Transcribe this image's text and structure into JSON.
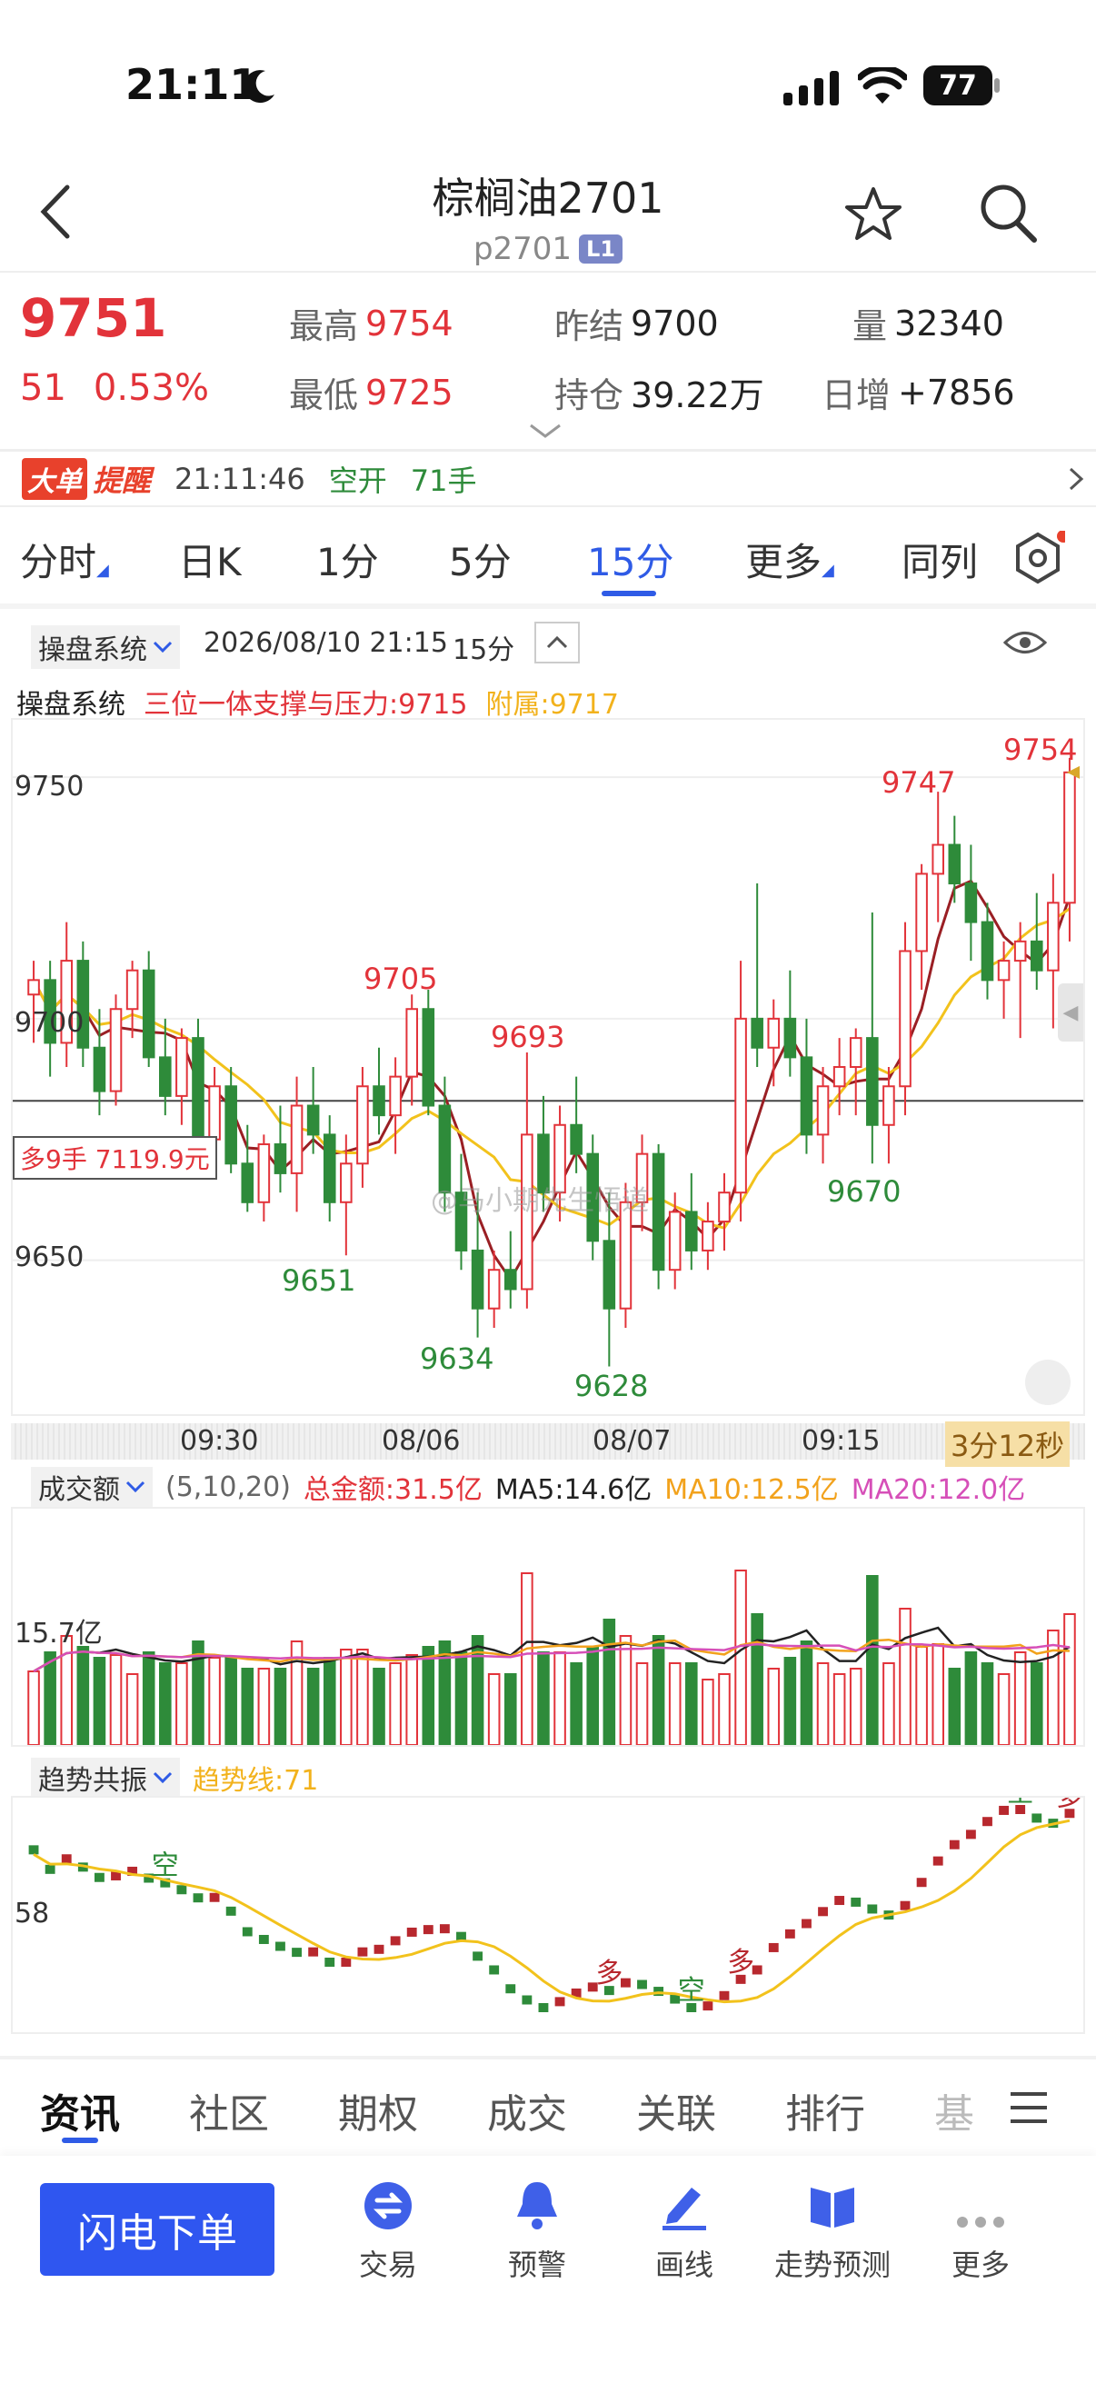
{
  "status_bar": {
    "time": "21:11",
    "battery": "77"
  },
  "header": {
    "title": "棕榈油2701",
    "code": "p2701",
    "level_badge": "L1"
  },
  "quote": {
    "price": "9751",
    "change": "51",
    "change_pct": "0.53%",
    "high_label": "最高",
    "high": "9754",
    "low_label": "最低",
    "low": "9725",
    "prev_settle_label": "昨结",
    "prev_settle": "9700",
    "oi_label": "持仓",
    "oi": "39.22万",
    "volume_label": "量",
    "volume": "32340",
    "daily_inc_label": "日增",
    "daily_inc": "+7856"
  },
  "alert": {
    "badge": "大单",
    "label": "提醒",
    "time": "21:11:46",
    "action": "空开",
    "lots": "71手"
  },
  "tabs": [
    {
      "label": "分时",
      "has_arrow": true
    },
    {
      "label": "日K"
    },
    {
      "label": "1分"
    },
    {
      "label": "5分"
    },
    {
      "label": "15分",
      "active": true
    },
    {
      "label": "更多",
      "has_arrow": true
    },
    {
      "label": "同列"
    }
  ],
  "chart_header": {
    "system_select": "操盘系统",
    "datetime": "2026/08/10 21:15",
    "period": "15分",
    "indicator_name": "操盘系统",
    "line1": "三位一体支撑与压力:9715",
    "line2": "附属:9717"
  },
  "main_chart": {
    "y_labels": [
      "9750",
      "9700",
      "9650"
    ],
    "x_labels": [
      "09:30",
      "08/06",
      "08/07",
      "09:15"
    ],
    "countdown": "3分12秒",
    "position_label": "多9手 7119.9元",
    "annotations": [
      "9754",
      "9747",
      "9705",
      "9693",
      "9651",
      "9634",
      "9628",
      "9670"
    ],
    "watermark": "@马小期先生悟道"
  },
  "volume_panel": {
    "select": "成交额",
    "params": "(5,10,20)",
    "total": "总金额:31.5亿",
    "ma5": "MA5:14.6亿",
    "ma10": "MA10:12.5亿",
    "ma20": "MA20:12.0亿",
    "y_label": "15.7亿"
  },
  "trend_panel": {
    "select": "趋势共振",
    "line": "趋势线:71",
    "y_label": "58",
    "tags": {
      "kong": "空",
      "duo": "多"
    }
  },
  "bottom_tabs": [
    "资讯",
    "社区",
    "期权",
    "成交",
    "关联",
    "排行",
    "基"
  ],
  "bottom_nav": {
    "primary": "闪电下单",
    "items": [
      "交易",
      "预警",
      "画线",
      "走势预测",
      "更多"
    ]
  },
  "chart_data": {
    "type": "candlestick",
    "title": "棕榈油2701 15分",
    "ylim": [
      9620,
      9760
    ],
    "series": [
      {
        "name": "candles",
        "ohlc": [
          [
            9705,
            9712,
            9695,
            9708
          ],
          [
            9708,
            9712,
            9688,
            9695
          ],
          [
            9695,
            9720,
            9690,
            9712
          ],
          [
            9712,
            9716,
            9690,
            9694
          ],
          [
            9694,
            9702,
            9680,
            9685
          ],
          [
            9685,
            9705,
            9682,
            9702
          ],
          [
            9702,
            9712,
            9696,
            9710
          ],
          [
            9710,
            9714,
            9690,
            9692
          ],
          [
            9692,
            9700,
            9680,
            9684
          ],
          [
            9684,
            9698,
            9678,
            9696
          ],
          [
            9696,
            9700,
            9672,
            9675
          ],
          [
            9675,
            9690,
            9668,
            9686
          ],
          [
            9686,
            9690,
            9668,
            9670
          ],
          [
            9670,
            9678,
            9660,
            9662
          ],
          [
            9662,
            9676,
            9658,
            9674
          ],
          [
            9674,
            9682,
            9664,
            9668
          ],
          [
            9668,
            9688,
            9660,
            9682
          ],
          [
            9682,
            9690,
            9672,
            9676
          ],
          [
            9676,
            9680,
            9658,
            9662
          ],
          [
            9662,
            9676,
            9651,
            9670
          ],
          [
            9670,
            9690,
            9665,
            9686
          ],
          [
            9686,
            9694,
            9676,
            9680
          ],
          [
            9680,
            9692,
            9672,
            9688
          ],
          [
            9688,
            9705,
            9682,
            9702
          ],
          [
            9702,
            9706,
            9680,
            9682
          ],
          [
            9682,
            9688,
            9660,
            9664
          ],
          [
            9664,
            9672,
            9648,
            9652
          ],
          [
            9652,
            9664,
            9634,
            9640
          ],
          [
            9640,
            9652,
            9636,
            9648
          ],
          [
            9648,
            9656,
            9640,
            9644
          ],
          [
            9644,
            9693,
            9640,
            9676
          ],
          [
            9676,
            9684,
            9660,
            9664
          ],
          [
            9664,
            9682,
            9658,
            9678
          ],
          [
            9678,
            9688,
            9668,
            9672
          ],
          [
            9672,
            9676,
            9650,
            9654
          ],
          [
            9654,
            9664,
            9628,
            9640
          ],
          [
            9640,
            9666,
            9636,
            9662
          ],
          [
            9662,
            9676,
            9656,
            9672
          ],
          [
            9672,
            9674,
            9644,
            9648
          ],
          [
            9648,
            9664,
            9644,
            9660
          ],
          [
            9660,
            9668,
            9648,
            9652
          ],
          [
            9652,
            9662,
            9648,
            9658
          ],
          [
            9658,
            9668,
            9652,
            9664
          ],
          [
            9664,
            9712,
            9658,
            9700
          ],
          [
            9700,
            9728,
            9690,
            9694
          ],
          [
            9694,
            9704,
            9686,
            9700
          ],
          [
            9700,
            9710,
            9688,
            9692
          ],
          [
            9692,
            9700,
            9672,
            9676
          ],
          [
            9676,
            9690,
            9670,
            9686
          ],
          [
            9686,
            9696,
            9680,
            9690
          ],
          [
            9690,
            9698,
            9680,
            9696
          ],
          [
            9696,
            9722,
            9670,
            9678
          ],
          [
            9678,
            9690,
            9670,
            9686
          ],
          [
            9686,
            9720,
            9680,
            9714
          ],
          [
            9714,
            9732,
            9706,
            9730
          ],
          [
            9730,
            9747,
            9720,
            9736
          ],
          [
            9736,
            9742,
            9724,
            9728
          ],
          [
            9728,
            9736,
            9712,
            9720
          ],
          [
            9720,
            9724,
            9704,
            9708
          ],
          [
            9708,
            9716,
            9700,
            9712
          ],
          [
            9712,
            9720,
            9696,
            9716
          ],
          [
            9716,
            9726,
            9706,
            9710
          ],
          [
            9710,
            9730,
            9698,
            9724
          ],
          [
            9724,
            9754,
            9716,
            9751
          ]
        ]
      }
    ]
  }
}
